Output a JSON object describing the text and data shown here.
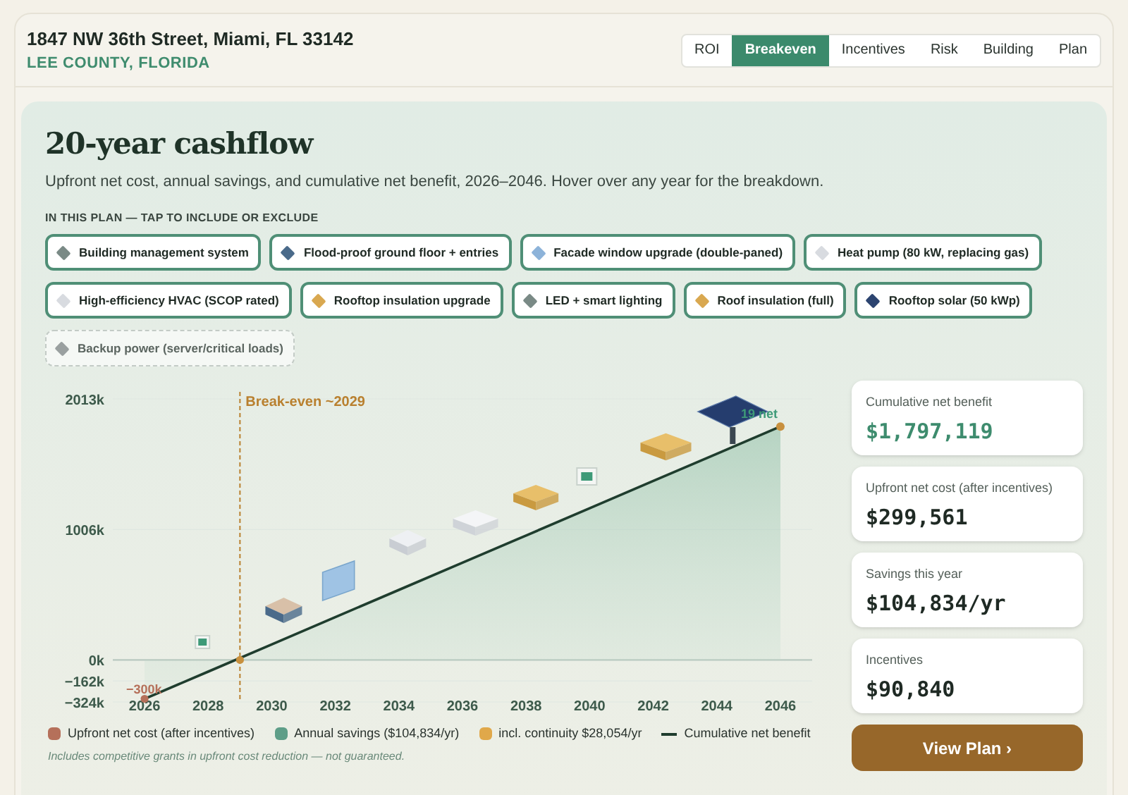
{
  "header": {
    "address": "1847 NW 36th Street, Miami, FL 33142",
    "county": "LEE COUNTY, FLORIDA"
  },
  "tabs": [
    {
      "label": "ROI",
      "selected": false
    },
    {
      "label": "Breakeven",
      "selected": true
    },
    {
      "label": "Incentives",
      "selected": false
    },
    {
      "label": "Risk",
      "selected": false
    },
    {
      "label": "Building",
      "selected": false
    },
    {
      "label": "Plan",
      "selected": false
    }
  ],
  "section": {
    "title": "20-year cashflow",
    "subtitle": "Upfront net cost, annual savings, and cumulative net benefit, 2026–2046. Hover over any year for the breakdown.",
    "plan_label": "IN THIS PLAN — TAP TO INCLUDE OR EXCLUDE"
  },
  "measures": [
    {
      "label": "Building management system",
      "included": true,
      "kind": "controls"
    },
    {
      "label": "Flood-proof ground floor + entries",
      "included": true,
      "kind": "flood"
    },
    {
      "label": "Facade window upgrade (double-paned)",
      "included": true,
      "kind": "window"
    },
    {
      "label": "Heat pump (80 kW, replacing gas)",
      "included": true,
      "kind": "unit"
    },
    {
      "label": "High-efficiency HVAC (SCOP rated)",
      "included": true,
      "kind": "unit"
    },
    {
      "label": "Rooftop insulation upgrade",
      "included": true,
      "kind": "insulation"
    },
    {
      "label": "LED + smart lighting",
      "included": true,
      "kind": "controls"
    },
    {
      "label": "Roof insulation (full)",
      "included": true,
      "kind": "insulation"
    },
    {
      "label": "Rooftop solar (50 kWp)",
      "included": true,
      "kind": "solar"
    },
    {
      "label": "Backup power (server/critical loads)",
      "included": false,
      "kind": "battery"
    }
  ],
  "chart_data": {
    "type": "area",
    "x": [
      2026,
      2028,
      2030,
      2032,
      2034,
      2036,
      2038,
      2040,
      2042,
      2044,
      2046
    ],
    "series": [
      {
        "name": "Cumulative net benefit",
        "color": "#1f3d2e",
        "values": [
          -300,
          -90,
          120,
          330,
          540,
          750,
          960,
          1170,
          1380,
          1590,
          1800
        ]
      }
    ],
    "xlim": [
      2025,
      2047
    ],
    "ylim": [
      -324,
      2013
    ],
    "xticks": [
      2026,
      2028,
      2030,
      2032,
      2034,
      2036,
      2038,
      2040,
      2042,
      2044,
      2046
    ],
    "yticks": [
      {
        "value": -324,
        "label": "−324k"
      },
      {
        "value": -162,
        "label": "−162k"
      },
      {
        "value": 0,
        "label": "0k"
      },
      {
        "value": 1006,
        "label": "1006k"
      },
      {
        "value": 2013,
        "label": "2013k"
      }
    ],
    "ref_lines": [
      {
        "axis": "x",
        "value": 2029,
        "label": "Break-even ~2029"
      }
    ],
    "annotations": [
      {
        "text": "−300k"
      },
      {
        "text": "19 net"
      }
    ]
  },
  "stats": [
    {
      "label": "Cumulative net benefit",
      "value": "$1,797,119",
      "highlight": true
    },
    {
      "label": "Upfront net cost (after incentives)",
      "value": "$299,561",
      "highlight": false
    },
    {
      "label": "Savings this year",
      "value": "$104,834/yr",
      "highlight": false
    },
    {
      "label": "Incentives",
      "value": "$90,840",
      "highlight": false
    }
  ],
  "cta": "View Plan ›",
  "legend": [
    {
      "label": "Upfront net cost (after incentives)",
      "color": "#b5705a",
      "kind": "dot"
    },
    {
      "label": "Annual savings ($104,834/yr)",
      "color": "#5e9e88",
      "kind": "dot"
    },
    {
      "label": "incl. continuity $28,054/yr",
      "color": "#e0a84a",
      "kind": "dot"
    },
    {
      "color": "#1f3d2e",
      "kind": "line"
    }
  ],
  "footnote": "Includes competitive grants in upfront cost reduction — not guaranteed."
}
